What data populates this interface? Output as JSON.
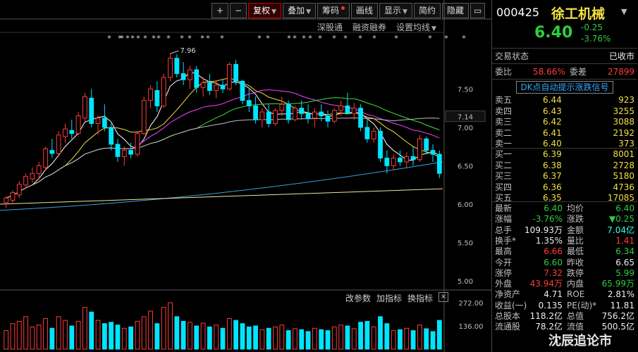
{
  "toolbar": {
    "buttons": [
      {
        "label": "+",
        "active": false,
        "dot": false,
        "caret": false
      },
      {
        "label": "−",
        "active": false,
        "dot": false,
        "caret": false
      },
      {
        "label": "复权",
        "active": true,
        "dot": false,
        "caret": true
      },
      {
        "label": "叠加",
        "active": false,
        "dot": false,
        "caret": true
      },
      {
        "label": "筹码",
        "active": false,
        "dot": true,
        "caret": false
      },
      {
        "label": "画线",
        "active": false,
        "dot": false,
        "caret": false
      },
      {
        "label": "显示",
        "active": false,
        "dot": false,
        "caret": true
      },
      {
        "label": "简约",
        "active": false,
        "dot": false,
        "caret": false
      },
      {
        "label": "隐藏",
        "active": false,
        "dot": false,
        "caret": false
      }
    ],
    "sub": [
      "深股通",
      "融资融券",
      "设置均线"
    ]
  },
  "chart_data": {
    "type": "candlestick",
    "annotation_high": "7.96",
    "last_price_tag": "7.14",
    "y_ticks": [
      "7.50",
      "7.00",
      "6.50",
      "6.00",
      "5.50",
      "5.00"
    ],
    "y_range": [
      4.9,
      8.2
    ],
    "candles": [
      [
        6.02,
        6.1,
        5.95,
        6.08
      ],
      [
        6.05,
        6.18,
        6.0,
        6.15
      ],
      [
        6.12,
        6.3,
        6.08,
        6.26
      ],
      [
        6.25,
        6.4,
        6.2,
        6.36
      ],
      [
        6.33,
        6.48,
        6.28,
        6.4
      ],
      [
        6.4,
        6.55,
        6.32,
        6.5
      ],
      [
        6.48,
        6.75,
        6.45,
        6.72
      ],
      [
        6.7,
        6.85,
        6.6,
        6.66
      ],
      [
        6.66,
        6.95,
        6.62,
        6.9
      ],
      [
        6.88,
        7.05,
        6.8,
        6.98
      ],
      [
        6.96,
        7.1,
        6.85,
        6.92
      ],
      [
        6.92,
        7.2,
        6.9,
        7.15
      ],
      [
        7.12,
        7.45,
        7.08,
        7.4
      ],
      [
        7.38,
        7.5,
        7.0,
        7.05
      ],
      [
        7.05,
        7.15,
        6.9,
        7.12
      ],
      [
        7.12,
        7.3,
        6.95,
        7.0
      ],
      [
        7.0,
        7.05,
        6.7,
        6.78
      ],
      [
        6.78,
        6.85,
        6.55,
        6.62
      ],
      [
        6.62,
        6.75,
        6.5,
        6.7
      ],
      [
        6.7,
        6.8,
        6.6,
        6.65
      ],
      [
        6.65,
        6.95,
        6.62,
        6.92
      ],
      [
        6.92,
        7.4,
        6.9,
        7.35
      ],
      [
        7.35,
        7.55,
        7.25,
        7.5
      ],
      [
        7.48,
        7.6,
        7.2,
        7.28
      ],
      [
        7.28,
        7.7,
        7.25,
        7.65
      ],
      [
        7.65,
        7.96,
        7.6,
        7.9
      ],
      [
        7.9,
        7.95,
        7.65,
        7.7
      ],
      [
        7.7,
        7.85,
        7.55,
        7.62
      ],
      [
        7.62,
        7.8,
        7.5,
        7.75
      ],
      [
        7.75,
        7.8,
        7.45,
        7.52
      ],
      [
        7.52,
        7.65,
        7.4,
        7.58
      ],
      [
        7.58,
        7.7,
        7.42,
        7.48
      ],
      [
        7.48,
        7.6,
        7.38,
        7.55
      ],
      [
        7.55,
        7.62,
        7.45,
        7.5
      ],
      [
        7.5,
        7.85,
        7.48,
        7.82
      ],
      [
        7.82,
        7.88,
        7.55,
        7.6
      ],
      [
        7.6,
        7.62,
        7.3,
        7.35
      ],
      [
        7.35,
        7.5,
        7.2,
        7.28
      ],
      [
        7.28,
        7.4,
        7.05,
        7.1
      ],
      [
        7.1,
        7.25,
        7.0,
        7.2
      ],
      [
        7.2,
        7.3,
        7.0,
        7.05
      ],
      [
        7.05,
        7.25,
        7.02,
        7.22
      ],
      [
        7.22,
        7.4,
        7.15,
        7.3
      ],
      [
        7.3,
        7.35,
        7.05,
        7.1
      ],
      [
        7.1,
        7.28,
        7.08,
        7.25
      ],
      [
        7.25,
        7.35,
        7.1,
        7.18
      ],
      [
        7.18,
        7.3,
        7.05,
        7.12
      ],
      [
        7.12,
        7.25,
        7.0,
        7.2
      ],
      [
        7.2,
        7.3,
        7.08,
        7.15
      ],
      [
        7.15,
        7.22,
        7.0,
        7.08
      ],
      [
        7.08,
        7.25,
        7.05,
        7.22
      ],
      [
        7.22,
        7.35,
        7.15,
        7.28
      ],
      [
        7.28,
        7.45,
        7.2,
        7.18
      ],
      [
        7.18,
        7.32,
        7.1,
        7.25
      ],
      [
        7.25,
        7.3,
        6.95,
        7.0
      ],
      [
        7.0,
        7.1,
        6.8,
        6.85
      ],
      [
        6.85,
        7.0,
        6.8,
        6.95
      ],
      [
        6.95,
        7.0,
        6.55,
        6.6
      ],
      [
        6.6,
        6.7,
        6.4,
        6.5
      ],
      [
        6.5,
        6.65,
        6.45,
        6.6
      ],
      [
        6.6,
        6.7,
        6.5,
        6.55
      ],
      [
        6.55,
        6.68,
        6.48,
        6.62
      ],
      [
        6.62,
        6.75,
        6.5,
        6.58
      ],
      [
        6.58,
        6.9,
        6.55,
        6.85
      ],
      [
        6.85,
        6.88,
        6.65,
        6.7
      ],
      [
        6.7,
        6.78,
        6.55,
        6.65
      ],
      [
        6.65,
        6.7,
        6.34,
        6.4
      ]
    ],
    "volumes": [
      40,
      55,
      60,
      70,
      48,
      52,
      66,
      45,
      70,
      62,
      50,
      60,
      90,
      80,
      62,
      55,
      58,
      52,
      45,
      48,
      60,
      70,
      82,
      55,
      90,
      100,
      70,
      60,
      58,
      50,
      56,
      48,
      52,
      45,
      66,
      62,
      55,
      48,
      50,
      42,
      45,
      48,
      52,
      40,
      44,
      42,
      38,
      45,
      42,
      40,
      48,
      52,
      50,
      44,
      58,
      60,
      48,
      70,
      55,
      40,
      42,
      45,
      40,
      52,
      44,
      38,
      62
    ],
    "volume_ticks": [
      "272.00",
      "136.00"
    ],
    "volume_max": 272
  },
  "indicators": [
    "改参数",
    "加指标",
    "换指标"
  ],
  "panel": {
    "code": "000425",
    "name": "徐工机械",
    "price": "6.40",
    "change": "-0.25",
    "change_pct": "-3.76%",
    "status_label": "交易状态",
    "status_value": "已收市",
    "wb_label": "委比",
    "wb_value": "58.66%",
    "wc_label": "委差",
    "wc_value": "27899",
    "signal": "DK点自动提示涨跌信号",
    "sell": [
      {
        "label": "卖五",
        "price": "6.44",
        "vol": "923"
      },
      {
        "label": "卖四",
        "price": "6.43",
        "vol": "3255"
      },
      {
        "label": "卖三",
        "price": "6.42",
        "vol": "3088"
      },
      {
        "label": "卖二",
        "price": "6.41",
        "vol": "2192"
      },
      {
        "label": "卖一",
        "price": "6.40",
        "vol": "373"
      }
    ],
    "buy": [
      {
        "label": "买一",
        "price": "6.39",
        "vol": "8001"
      },
      {
        "label": "买二",
        "price": "6.38",
        "vol": "2728"
      },
      {
        "label": "买三",
        "price": "6.37",
        "vol": "5180"
      },
      {
        "label": "买四",
        "price": "6.36",
        "vol": "4736"
      },
      {
        "label": "买五",
        "price": "6.35",
        "vol": "17085"
      }
    ],
    "stats": [
      {
        "l1": "最新",
        "v1": "6.40",
        "c1": "green",
        "l2": "均价",
        "v2": "6.40",
        "c2": "green"
      },
      {
        "l1": "涨幅",
        "v1": "-3.76%",
        "c1": "green",
        "l2": "涨跌",
        "v2": "▼0.25",
        "c2": "green"
      },
      {
        "l1": "总手",
        "v1": "109.93万",
        "c1": "white",
        "l2": "金额",
        "v2": "7.04亿",
        "c2": "cyan"
      },
      {
        "l1": "换手*",
        "v1": "1.35%",
        "c1": "white",
        "l2": "量比",
        "v2": "1.41",
        "c2": "red"
      },
      {
        "l1": "最高",
        "v1": "6.66",
        "c1": "red",
        "l2": "最低",
        "v2": "6.34",
        "c2": "green"
      },
      {
        "l1": "今开",
        "v1": "6.60",
        "c1": "green",
        "l2": "昨收",
        "v2": "6.65",
        "c2": "white"
      },
      {
        "l1": "涨停",
        "v1": "7.32",
        "c1": "red",
        "l2": "跌停",
        "v2": "5.99",
        "c2": "green"
      },
      {
        "l1": "外盘",
        "v1": "43.94万",
        "c1": "red",
        "l2": "内盘",
        "v2": "65.99万",
        "c2": "green"
      },
      {
        "l1": "净资产",
        "v1": "4.71",
        "c1": "white",
        "l2": "ROE",
        "v2": "2.81%",
        "c2": "white"
      },
      {
        "l1": "收益(一)",
        "v1": "0.135",
        "c1": "white",
        "l2": "PE(动)*",
        "v2": "11.81",
        "c2": "white"
      },
      {
        "l1": "总股本",
        "v1": "118.2亿",
        "c1": "white",
        "l2": "总值",
        "v2": "756.2亿",
        "c2": "white"
      },
      {
        "l1": "流通股",
        "v1": "78.2亿",
        "c1": "white",
        "l2": "流值",
        "v2": "500.5亿",
        "c2": "white"
      }
    ]
  },
  "watermark": "沈辰追论市",
  "colors": {
    "up": "#ff3b3b",
    "down": "#00e5ff",
    "ma5": "#ffffff",
    "ma10": "#f0e040",
    "ma20": "#ff40ff",
    "ma30": "#40e040",
    "ma60": "#bfbfbf",
    "ma120": "#3aa0e0",
    "ma250": "#e8e8a0"
  }
}
